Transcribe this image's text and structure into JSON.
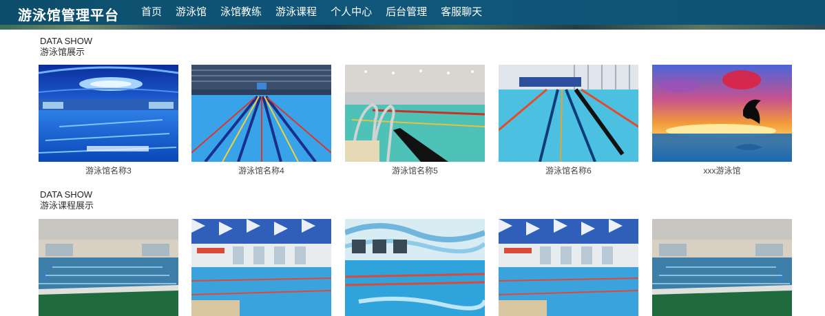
{
  "header": {
    "brand": "游泳馆管理平台",
    "menu": [
      {
        "label": "首页",
        "active": true
      },
      {
        "label": "游泳馆"
      },
      {
        "label": "泳馆教练"
      },
      {
        "label": "游泳课程"
      },
      {
        "label": "个人中心"
      },
      {
        "label": "后台管理"
      },
      {
        "label": "客服聊天"
      }
    ]
  },
  "venues": {
    "section_en": "DATA SHOW",
    "section_cn": "游泳馆展示",
    "items": [
      {
        "name": "游泳馆名称3",
        "image": "indoor-pool-blue-ceiling"
      },
      {
        "name": "游泳馆名称4",
        "image": "competition-pool-lanes"
      },
      {
        "name": "游泳馆名称5",
        "image": "pool-with-ladder"
      },
      {
        "name": "游泳馆名称6",
        "image": "lane-pool-windows"
      },
      {
        "name": "xxx游泳馆",
        "image": "dolphin-sunset"
      }
    ]
  },
  "courses": {
    "section_en": "DATA SHOW",
    "section_cn": "游泳课程展示",
    "items": [
      {
        "image": "indoor-pool-green-edge"
      },
      {
        "image": "pool-blue-ceiling-swimmers"
      },
      {
        "image": "pool-wave-ceiling"
      },
      {
        "image": "pool-blue-ceiling-swimmers"
      },
      {
        "image": "indoor-pool-green-edge"
      }
    ]
  },
  "colors": {
    "nav_bg": "#0f5273",
    "arrow": "#2f7fd0"
  }
}
